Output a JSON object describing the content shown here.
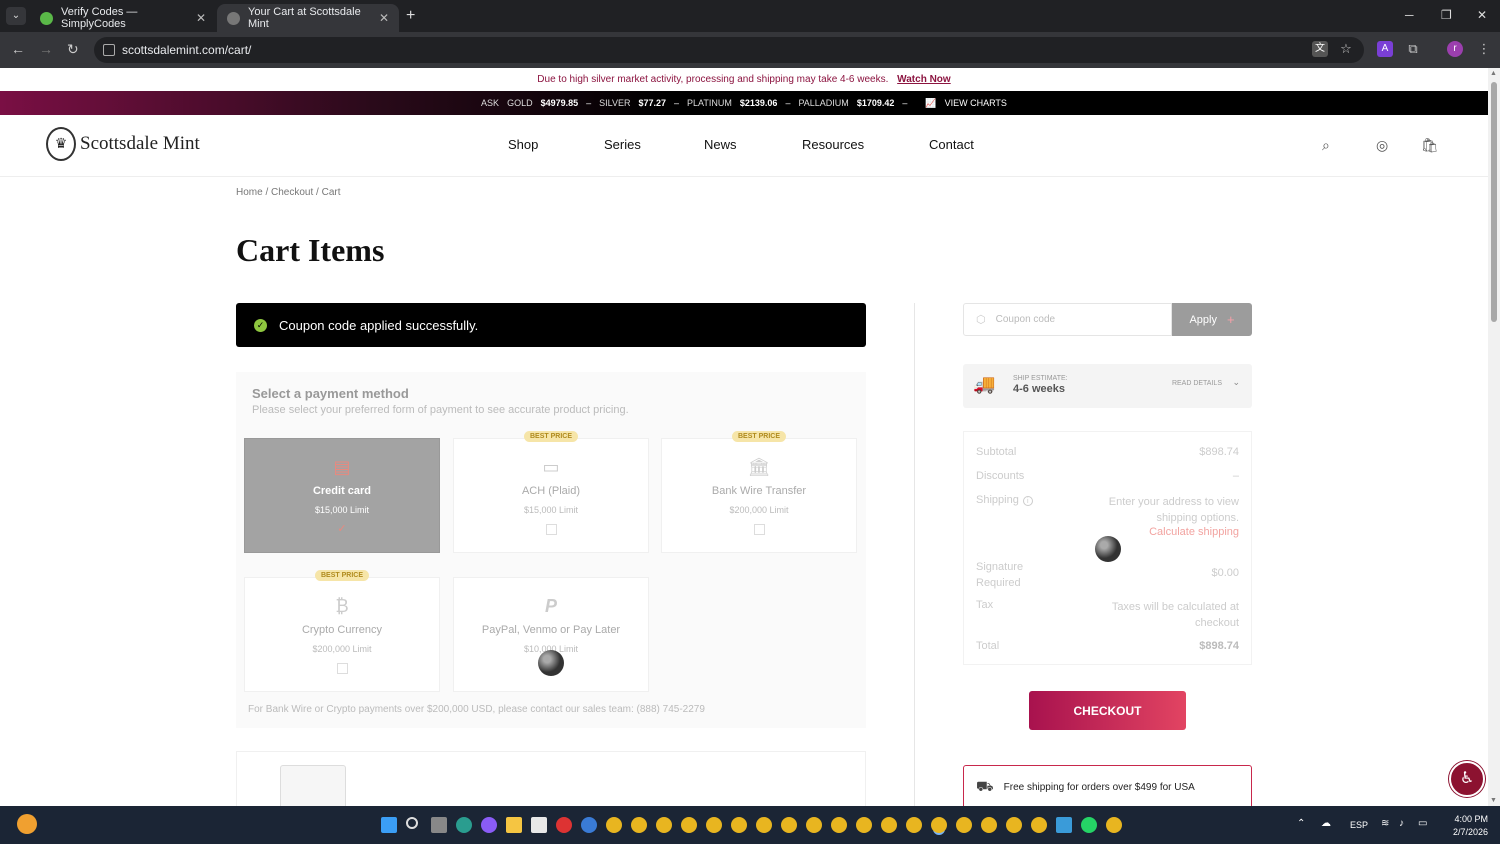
{
  "browser": {
    "tabs": [
      {
        "title": "Verify Codes — SimplyCodes",
        "active": false
      },
      {
        "title": "Your Cart at Scottsdale Mint",
        "active": true
      }
    ],
    "url": "scottsdalemint.com/cart/"
  },
  "announcement": {
    "text": "Due to high silver market activity, processing and shipping may take 4-6 weeks.",
    "link": "Watch Now"
  },
  "ticker": {
    "ask_label": "ASK",
    "metals": [
      {
        "name": "GOLD",
        "price": "$4979.85"
      },
      {
        "name": "SILVER",
        "price": "$77.27"
      },
      {
        "name": "PLATINUM",
        "price": "$2139.06"
      },
      {
        "name": "PALLADIUM",
        "price": "$1709.42"
      }
    ],
    "charts_link": "VIEW CHARTS"
  },
  "header": {
    "brand": "Scottsdale Mint",
    "nav": [
      "Shop",
      "Series",
      "News",
      "Resources",
      "Contact"
    ]
  },
  "breadcrumb": "Home / Checkout / Cart",
  "page_title": "Cart Items",
  "notice": "Coupon code applied successfully.",
  "payment": {
    "title": "Select a payment method",
    "subtitle": "Please select your preferred form of payment to see accurate product pricing.",
    "methods": [
      {
        "name": "Credit card",
        "limit": "$15,000 Limit",
        "badge": "",
        "selected": true
      },
      {
        "name": "ACH (Plaid)",
        "limit": "$15,000 Limit",
        "badge": "BEST PRICE",
        "selected": false
      },
      {
        "name": "Bank Wire Transfer",
        "limit": "$200,000 Limit",
        "badge": "BEST PRICE",
        "selected": false
      },
      {
        "name": "Crypto Currency",
        "limit": "$200,000 Limit",
        "badge": "BEST PRICE",
        "selected": false
      },
      {
        "name": "PayPal, Venmo or Pay Later",
        "limit": "$10,000 Limit",
        "badge": "",
        "selected": false
      }
    ],
    "note": "For Bank Wire or Crypto payments over $200,000 USD, please contact our sales team: (888) 745-2279"
  },
  "coupon": {
    "placeholder": "Coupon code",
    "apply_label": "Apply"
  },
  "ship_estimate": {
    "label": "SHIP ESTIMATE:",
    "value": "4-6 weeks",
    "details": "READ DETAILS"
  },
  "summary": {
    "subtotal_label": "Subtotal",
    "subtotal": "$898.74",
    "discounts_label": "Discounts",
    "discounts": "–",
    "shipping_label": "Shipping",
    "shipping_text": "Enter your address to view shipping options.",
    "shipping_link": "Calculate shipping",
    "signature_label": "Signature Required",
    "signature": "$0.00",
    "tax_label": "Tax",
    "tax": "Taxes will be calculated at checkout",
    "total_label": "Total",
    "total": "$898.74"
  },
  "checkout_label": "CHECKOUT",
  "free_shipping": "Free shipping for orders over $499 for USA",
  "taskbar": {
    "lang": "ESP",
    "time": "4:00 PM",
    "date": "2/7/2026"
  },
  "colors": {
    "brand": "#a8124e",
    "accent": "#e24462",
    "notice_bg": "#000000",
    "success": "#8ec63f"
  }
}
